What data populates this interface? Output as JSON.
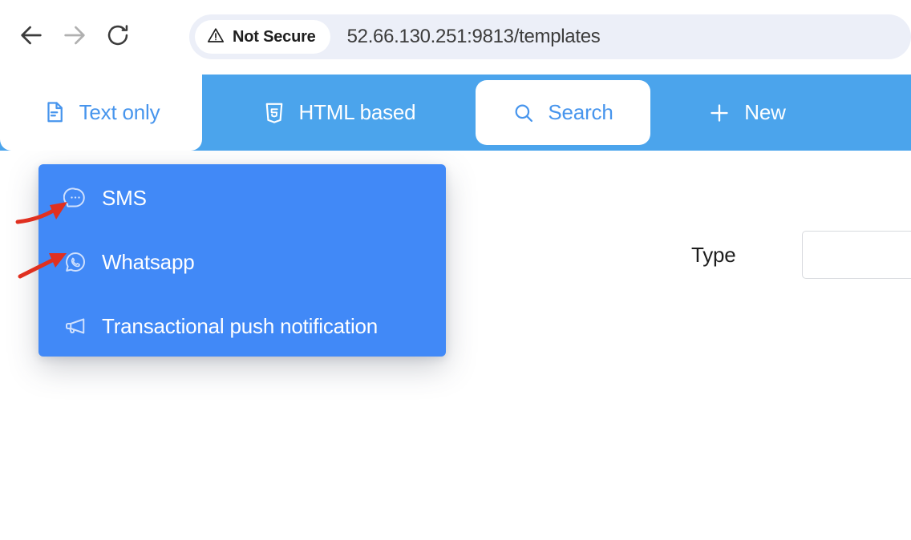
{
  "browser": {
    "back_icon": "arrow-left-icon",
    "forward_icon": "arrow-right-icon",
    "reload_icon": "reload-icon",
    "security_badge": {
      "icon": "warning-triangle-icon",
      "label": "Not Secure"
    },
    "url": "52.66.130.251:9813/templates"
  },
  "tabbar": {
    "background_color": "#4ba4ec",
    "active_color": "#ffffff",
    "tabs": [
      {
        "label": "Text only",
        "icon": "document-text-icon",
        "state": "active"
      },
      {
        "label": "HTML based",
        "icon": "html5-shield-icon",
        "state": "inactive"
      },
      {
        "label": "Search",
        "icon": "search-icon",
        "state": "highlighted"
      },
      {
        "label": "New",
        "icon": "plus-icon",
        "state": "inactive"
      }
    ]
  },
  "dropdown": {
    "background_color": "#4189f7",
    "items": [
      {
        "label": "SMS",
        "icon": "chat-bubble-dots-icon"
      },
      {
        "label": "Whatsapp",
        "icon": "whatsapp-icon"
      },
      {
        "label": "Transactional push notification",
        "icon": "megaphone-icon"
      }
    ]
  },
  "form": {
    "type_label": "Type",
    "type_value": "",
    "type_placeholder": ""
  },
  "annotations": {
    "color": "#e03020",
    "arrows": [
      {
        "target": "SMS",
        "icon": "red-arrow-icon"
      },
      {
        "target": "Whatsapp",
        "icon": "red-arrow-icon"
      }
    ]
  }
}
